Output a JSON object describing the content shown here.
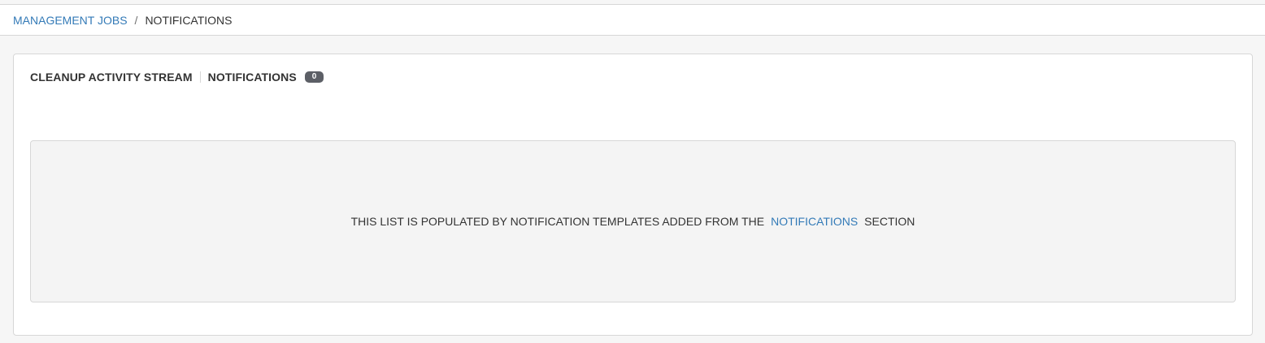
{
  "breadcrumb": {
    "parent_label": "MANAGEMENT JOBS",
    "separator": "/",
    "current_label": "NOTIFICATIONS"
  },
  "panel": {
    "title": "CLEANUP ACTIVITY STREAM",
    "tab_label": "NOTIFICATIONS",
    "count": "0"
  },
  "empty_state": {
    "text_before": "THIS LIST IS POPULATED BY NOTIFICATION TEMPLATES ADDED FROM THE",
    "link_label": "NOTIFICATIONS",
    "text_after": "SECTION"
  },
  "colors": {
    "link": "#337ab7",
    "text": "#333333",
    "badge_bg": "#5c5f66",
    "empty_bg": "#f4f4f4",
    "border": "#d7d7d7"
  }
}
